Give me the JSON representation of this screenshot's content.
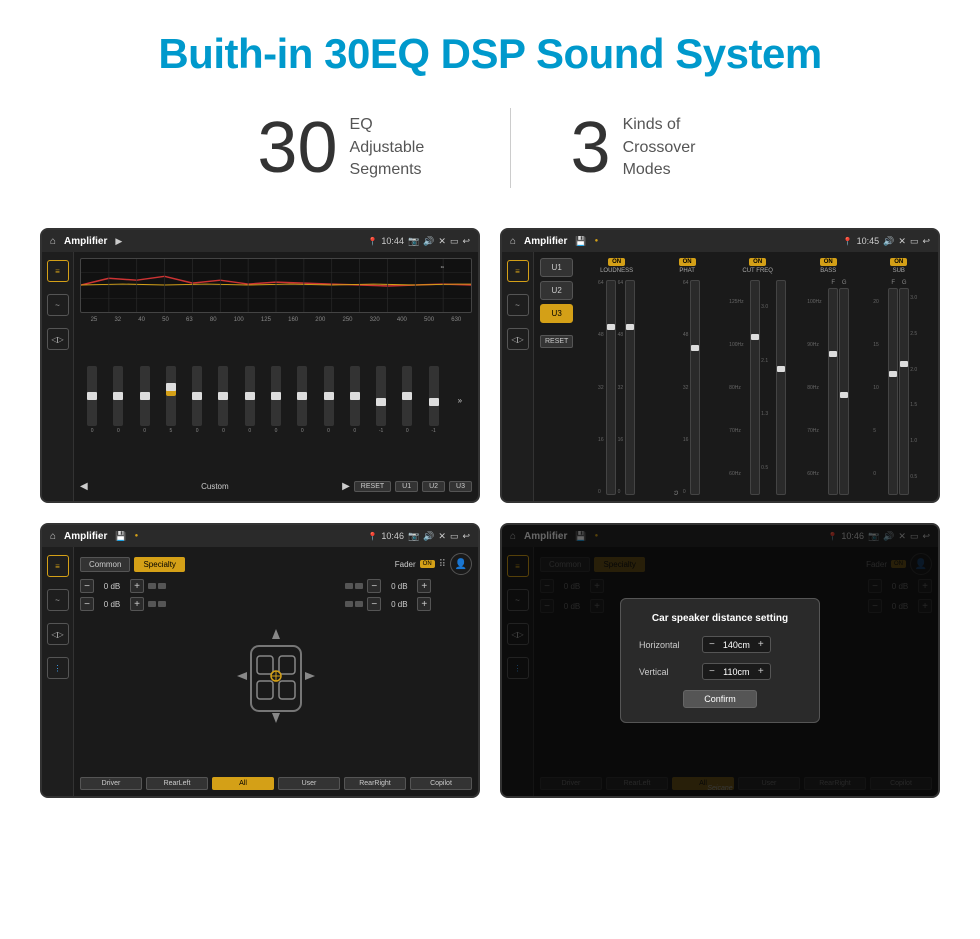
{
  "page": {
    "title": "Buith-in 30EQ DSP Sound System"
  },
  "stats": {
    "eq_number": "30",
    "eq_desc_line1": "EQ Adjustable",
    "eq_desc_line2": "Segments",
    "crossover_number": "3",
    "crossover_desc_line1": "Kinds of",
    "crossover_desc_line2": "Crossover Modes"
  },
  "screen1": {
    "title": "Amplifier",
    "time": "10:44",
    "eq_labels": [
      "25",
      "32",
      "40",
      "50",
      "63",
      "80",
      "100",
      "125",
      "160",
      "200",
      "250",
      "320",
      "400",
      "500",
      "630"
    ],
    "eq_values": [
      "0",
      "0",
      "0",
      "5",
      "0",
      "0",
      "0",
      "0",
      "0",
      "0",
      "0",
      "-1",
      "0",
      "-1"
    ],
    "bottom_btns": [
      "Custom",
      "RESET",
      "U1",
      "U2",
      "U3"
    ]
  },
  "screen2": {
    "title": "Amplifier",
    "time": "10:45",
    "presets": [
      "U1",
      "U2",
      "U3"
    ],
    "active_preset": "U3",
    "channels": [
      {
        "name": "LOUDNESS",
        "on": true,
        "labels": [
          "64",
          "48",
          "32",
          "16",
          "0"
        ]
      },
      {
        "name": "PHAT",
        "on": true,
        "labels": [
          "64",
          "48",
          "32",
          "16",
          "0"
        ]
      },
      {
        "name": "CUT FREQ",
        "on": true,
        "labels": [
          "3.0",
          "2.1",
          "1.3",
          "0.5"
        ],
        "freq_labels": [
          "125Hz",
          "100Hz",
          "80Hz",
          "70Hz",
          "60Hz"
        ]
      },
      {
        "name": "BASS",
        "on": true,
        "labels": [
          "100Hz",
          "90Hz",
          "80Hz",
          "70Hz",
          "60Hz"
        ],
        "g_labels": [
          "F",
          "G"
        ]
      },
      {
        "name": "SUB",
        "on": true,
        "labels": [
          "3.0",
          "2.5",
          "2.0",
          "1.5",
          "1.0",
          "0.5"
        ],
        "g_labels": [
          "F",
          "G"
        ]
      }
    ],
    "reset_label": "RESET"
  },
  "screen3": {
    "title": "Amplifier",
    "time": "10:46",
    "tabs": [
      "Common",
      "Specialty"
    ],
    "active_tab": "Specialty",
    "fader_label": "Fader",
    "fader_on": "ON",
    "controls": [
      {
        "label": "0 dB"
      },
      {
        "label": "0 dB"
      },
      {
        "label": "0 dB"
      },
      {
        "label": "0 dB"
      }
    ],
    "bottom_btns": [
      "Driver",
      "RearLeft",
      "All",
      "User",
      "RearRight",
      "Copilot"
    ],
    "active_bottom": "All"
  },
  "screen4": {
    "title": "Amplifier",
    "time": "10:46",
    "tabs": [
      "Common",
      "Specialty"
    ],
    "active_tab": "Specialty",
    "dialog": {
      "title": "Car speaker distance setting",
      "horizontal_label": "Horizontal",
      "horizontal_value": "140cm",
      "vertical_label": "Vertical",
      "vertical_value": "110cm",
      "confirm_label": "Confirm"
    },
    "bottom_btns": [
      "Driver",
      "RearLeft",
      "All",
      "User",
      "RearRight",
      "Copilot"
    ],
    "watermark": "Seicane"
  }
}
